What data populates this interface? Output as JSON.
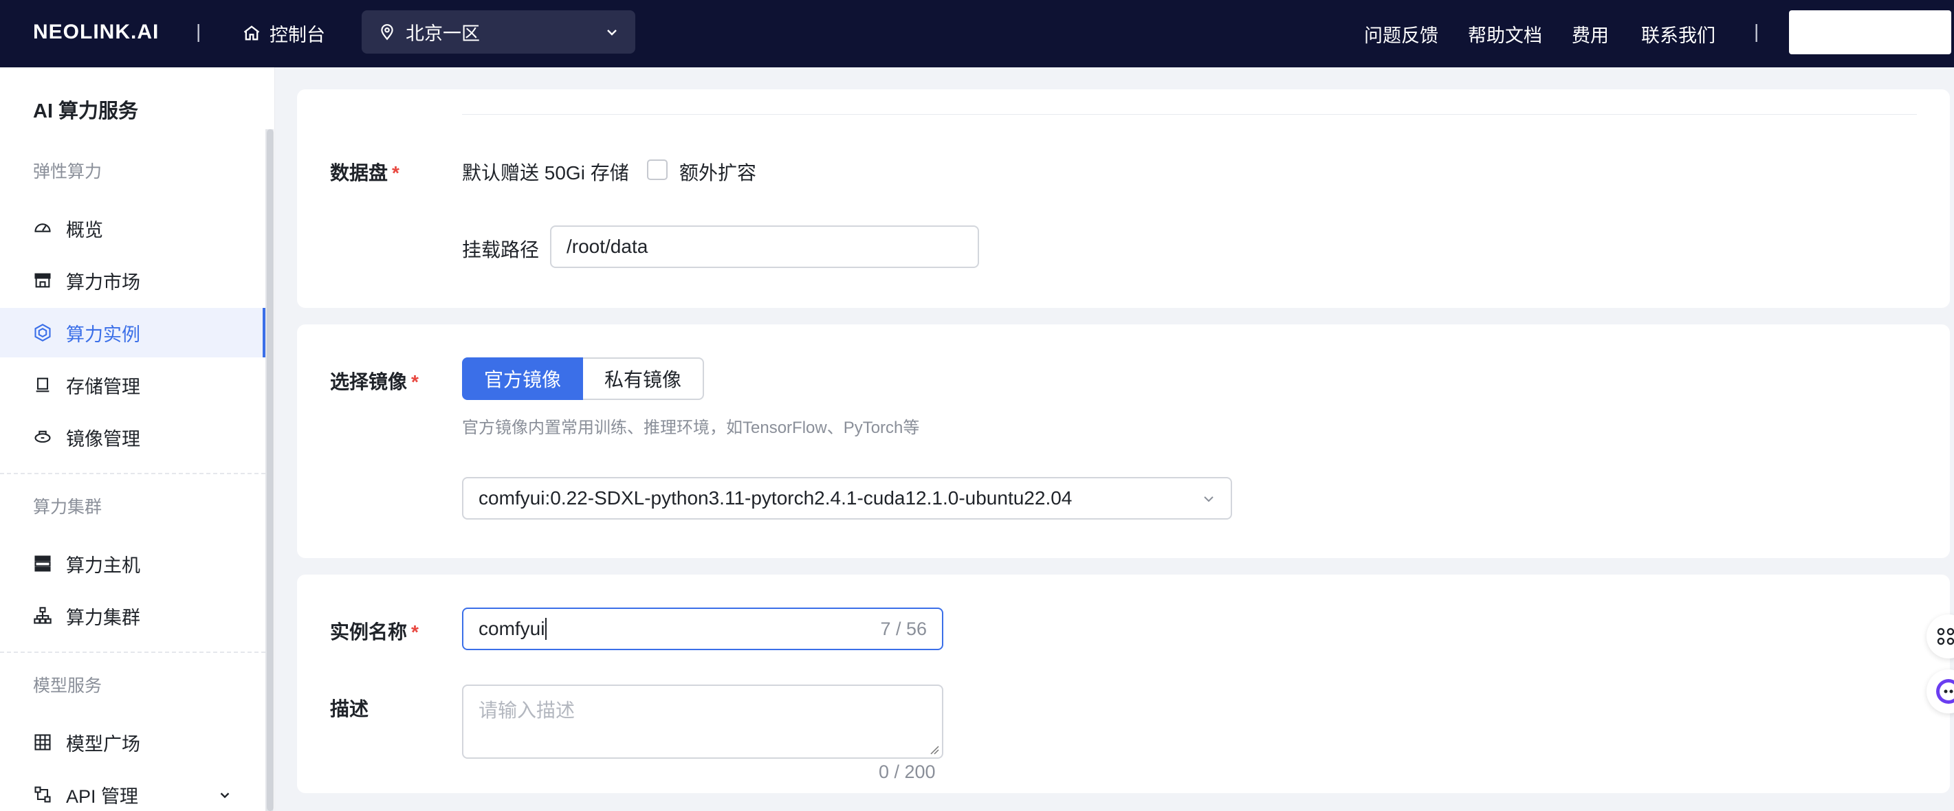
{
  "topbar": {
    "logo": "NEOLINK.AI",
    "separator": "|",
    "home_label": "控制台",
    "region": "北京一区",
    "nav": [
      "问题反馈",
      "帮助文档",
      "费用",
      "联系我们"
    ]
  },
  "sidebar": {
    "title": "AI 算力服务",
    "groups": {
      "elastic": "弹性算力",
      "cluster": "算力集群",
      "model": "模型服务"
    },
    "items": {
      "overview": "概览",
      "market": "算力市场",
      "instances": "算力实例",
      "storage": "存储管理",
      "images": "镜像管理",
      "hosts": "算力主机",
      "clusters": "算力集群",
      "model_square": "模型广场",
      "api": "API 管理"
    },
    "active": "instances"
  },
  "datadisk": {
    "label": "数据盘",
    "required_mark": "*",
    "gift_text": "默认赠送 50Gi 存储",
    "expand_label": "额外扩容",
    "mount_label": "挂载路径",
    "mount_value": "/root/data"
  },
  "image_select": {
    "label": "选择镜像",
    "required_mark": "*",
    "tabs": [
      "官方镜像",
      "私有镜像"
    ],
    "active_tab": 0,
    "hint": "官方镜像内置常用训练、推理环境，如TensorFlow、PyTorch等",
    "selected_image": "comfyui:0.22-SDXL-python3.11-pytorch2.4.1-cuda12.1.0-ubuntu22.04"
  },
  "instance": {
    "name_label": "实例名称",
    "required_mark": "*",
    "name_value": "comfyui",
    "name_count": "7 / 56",
    "desc_label": "描述",
    "desc_placeholder": "请输入描述",
    "desc_count": "0 / 200"
  },
  "colors": {
    "topbar_bg": "#0e1233",
    "accent": "#3b6fe8",
    "required": "#e8473f"
  }
}
